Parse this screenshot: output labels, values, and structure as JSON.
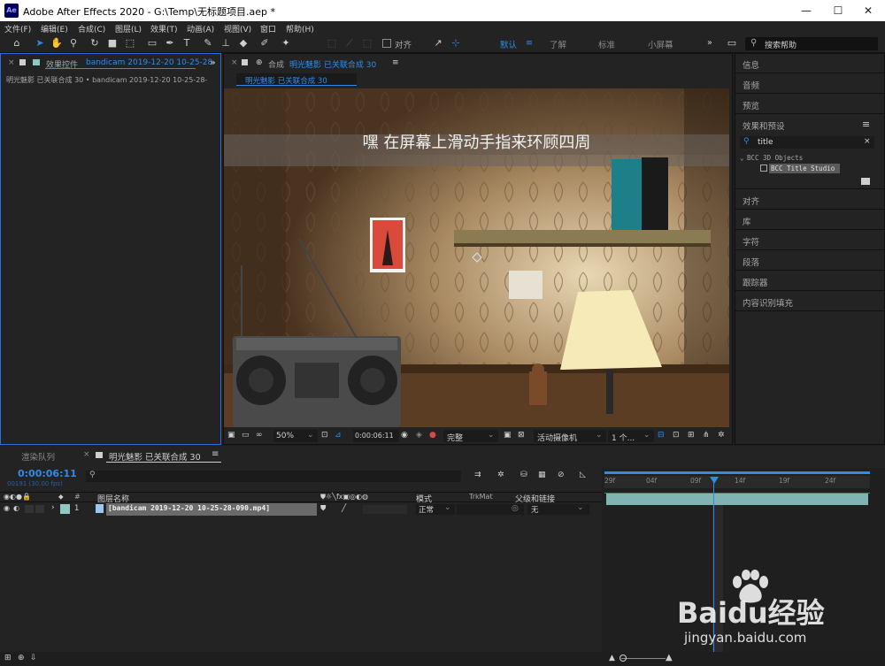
{
  "window": {
    "app_icon": "Ae",
    "title": "Adobe After Effects 2020 - G:\\Temp\\无标题项目.aep *",
    "controls": [
      "—",
      "☐",
      "✕"
    ]
  },
  "menu": [
    "文件(F)",
    "编辑(E)",
    "合成(C)",
    "图层(L)",
    "效果(T)",
    "动画(A)",
    "视图(V)",
    "窗口",
    "帮助(H)"
  ],
  "toolbar": {
    "align_label": "对齐",
    "workspaces": [
      "默认",
      "了解",
      "标准",
      "小屏幕"
    ],
    "search_placeholder": "搜索帮助"
  },
  "effects_panel": {
    "tab_prefix": "效果控件",
    "tab_name": "bandicam 2019-12-20 10-25-28-",
    "breadcrumb": "明光魅影 已关联合成 30 • bandicam 2019-12-20 10-25-28-"
  },
  "comp_panel": {
    "tab_prefix": "合成",
    "tab_name": "明光魅影 已关联合成 30",
    "sub_tab": "明光魅影 已关联合成 30",
    "viewer_caption": "嘿 在屏幕上滑动手指来环顾四周",
    "zoom": "50%",
    "timecode": "0:00:06:11",
    "resolution": "完整",
    "camera": "活动摄像机",
    "views": "1 个..."
  },
  "right_panel": {
    "items_top": [
      "信息",
      "音频",
      "预览"
    ],
    "effects_presets_label": "效果和预设",
    "search_value": "title",
    "tree_group": "BCC 3D Objects",
    "tree_item": "BCC Title Studio",
    "items_bottom": [
      "对齐",
      "库",
      "字符",
      "段落",
      "跟踪器",
      "内容识别填充"
    ]
  },
  "timeline": {
    "tab_render": "渲染队列",
    "tab_comp": "明光魅影 已关联合成 30",
    "timecode": "0:00:06:11",
    "frame_info": "00191 (30.00 fps)",
    "col_layer_name": "图层名称",
    "col_num": "#",
    "col_mode": "模式",
    "col_trkmat": "TrkMat",
    "col_parent": "父级和链接",
    "layer": {
      "index": "1",
      "name": "[bandicam 2019-12-20 10-25-28-090.mp4]",
      "mode": "正常",
      "parent": "无"
    },
    "ruler_ticks": [
      "29f",
      "04f",
      "09f",
      "14f",
      "19f",
      "24f"
    ],
    "playhead_fraction": 0.41
  },
  "watermark": {
    "brand": "Baidu经验",
    "url": "jingyan.baidu.com"
  },
  "colors": {
    "accent": "#2d8ceb",
    "layer_label": "#8fc8c2",
    "layer_bar": "#7fb4b2"
  }
}
